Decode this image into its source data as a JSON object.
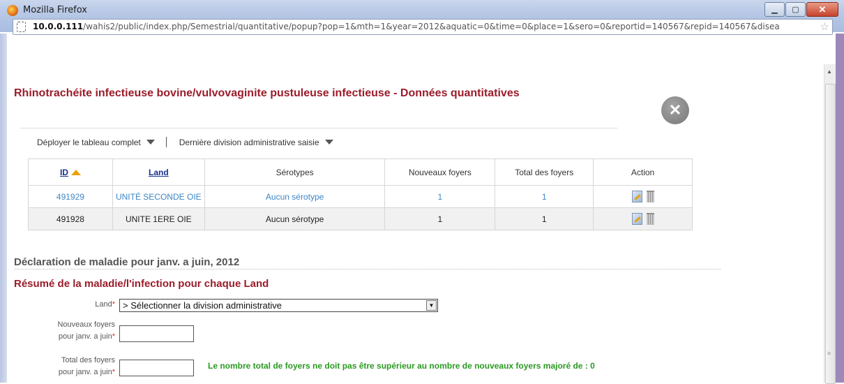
{
  "window": {
    "title": "Mozilla Firefox",
    "minimize": "▁",
    "maximize": "▢",
    "close": "✕",
    "url_host": "10.0.0.111",
    "url_rest": "/wahis2/public/index.php/Semestrial/quantitative/popup?pop=1&mth=1&year=2012&aquatic=0&time=0&place=1&sero=0&reportid=140567&repid=140567&disea"
  },
  "page": {
    "title": "Rhinotrachéite infectieuse bovine/vulvovaginite pustuleuse infectieuse - Données quantitatives",
    "close_symbol": "✕"
  },
  "toolbar": {
    "expand_label": "Déployer le tableau complet",
    "last_division_label": "Dernière division administrative saisie"
  },
  "table": {
    "headers": {
      "id": "ID",
      "land": "Land",
      "serotypes": "Sérotypes",
      "new_outbreaks": "Nouveaux foyers",
      "total_outbreaks": "Total des foyers",
      "action": "Action"
    },
    "rows": [
      {
        "id": "491929",
        "land": "UNITÉ SECONDE OIE",
        "serotype": "Aucun sérotype",
        "new": "1",
        "total": "1"
      },
      {
        "id": "491928",
        "land": "UNITE 1ERE OIE",
        "serotype": "Aucun sérotype",
        "new": "1",
        "total": "1"
      }
    ]
  },
  "declaration": {
    "heading": "Déclaration de maladie pour janv. a juin, 2012",
    "summary_heading": "Résumé de la maladie/l'infection pour chaque Land"
  },
  "form": {
    "land_label": "Land",
    "land_select_value": "> Sélectionner la division administrative",
    "new_label_1": "Nouveaux foyers",
    "new_label_2": "pour janv. a juin",
    "new_value": "",
    "total_label_1": "Total des foyers",
    "total_label_2": "pour janv. a juin",
    "total_value": "",
    "required_mark": "*",
    "hint": "Le nombre total de foyers ne doit pas être supérieur au nombre de nouveaux foyers majoré de : 0"
  },
  "colors": {
    "title_red": "#9b1c2a",
    "link_blue": "#17318f",
    "row_blue": "#3d86c6",
    "hint_green": "#2a9a22"
  }
}
